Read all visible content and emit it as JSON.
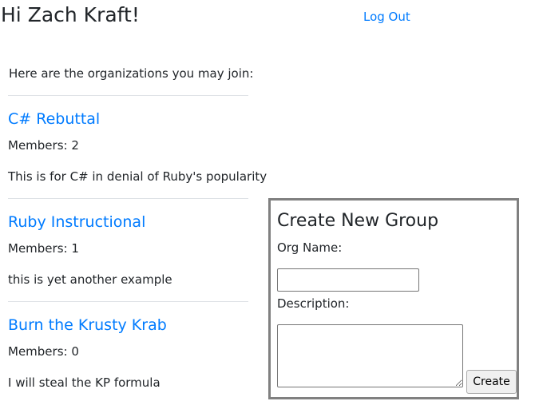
{
  "header": {
    "greeting": "Hi Zach Kraft!",
    "logout_label": "Log Out"
  },
  "main": {
    "intro": "Here are the organizations you may join:",
    "organizations": [
      {
        "name": "C# Rebuttal",
        "members": "Members: 2",
        "description": "This is for C# in denial of Ruby's popularity"
      },
      {
        "name": "Ruby Instructional",
        "members": "Members: 1",
        "description": "this is yet another example"
      },
      {
        "name": "Burn the Krusty Krab",
        "members": "Members: 0",
        "description": "I will steal the KP formula"
      }
    ]
  },
  "create_group": {
    "title": "Create New Group",
    "org_name_label": "Org Name:",
    "org_name_value": "",
    "description_label": "Description:",
    "description_value": "",
    "submit_label": "Create"
  },
  "colors": {
    "link": "#007bff",
    "text": "#212529",
    "divider": "#dee2e6",
    "box_border": "#808080"
  }
}
